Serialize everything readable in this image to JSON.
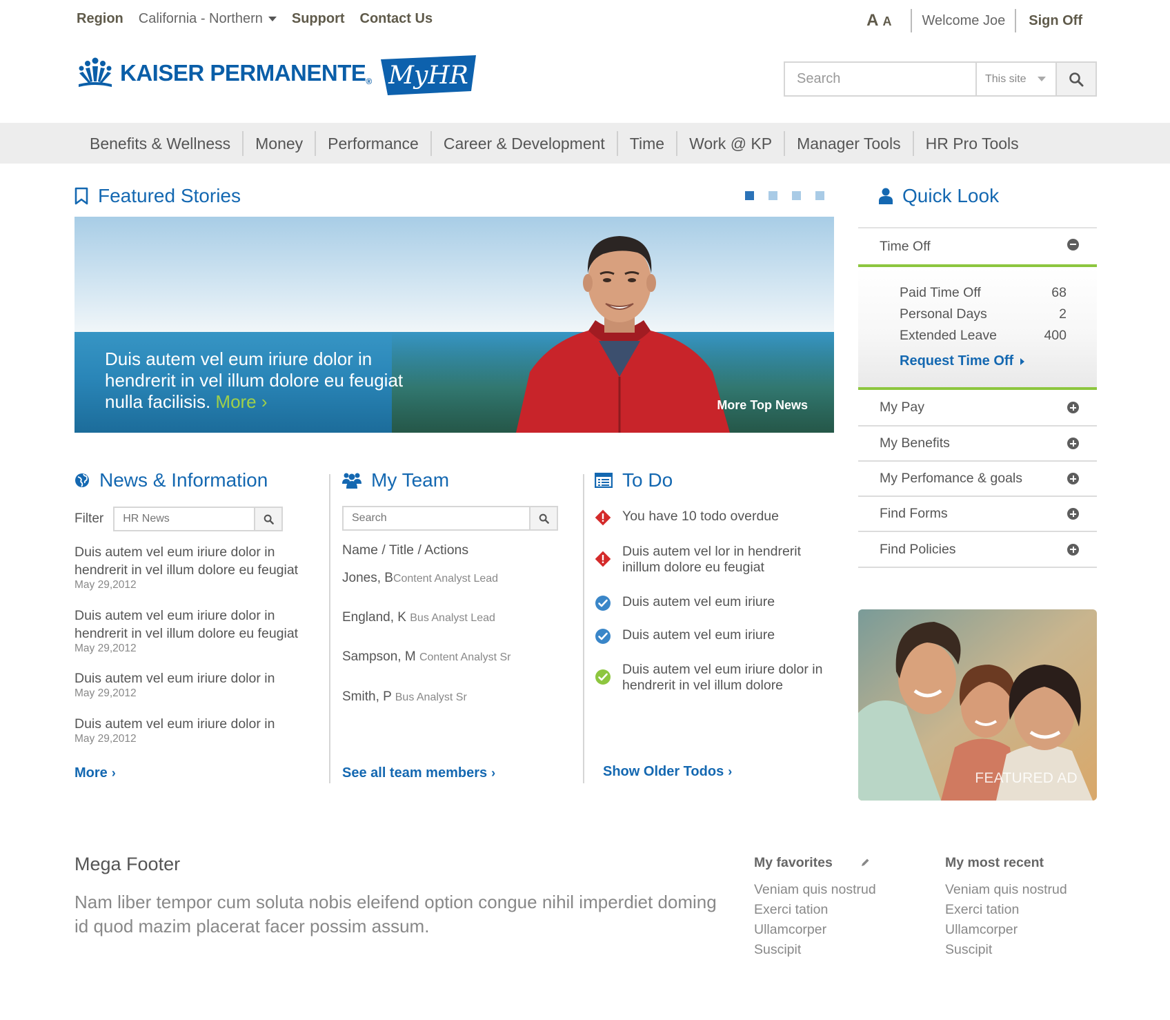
{
  "utility": {
    "region_label": "Region",
    "region_value": "California - Northern",
    "support": "Support",
    "contact": "Contact Us",
    "text_size_large": "A",
    "text_size_small": "A",
    "welcome": "Welcome Joe",
    "sign_off": "Sign Off"
  },
  "brand": {
    "name": "KAISER PERMANENTE",
    "registered": "®",
    "app_logo": "MyHR",
    "brand_color": "#0a5ea8",
    "accent_green": "#8dc63f"
  },
  "search": {
    "placeholder": "Search",
    "scope": "This site"
  },
  "nav": {
    "items": [
      "Benefits & Wellness",
      "Money",
      "Performance",
      "Career & Development",
      "Time",
      "Work @ KP",
      "Manager Tools",
      "HR Pro Tools"
    ]
  },
  "featured": {
    "title": "Featured Stories",
    "caption": "Duis autem vel eum iriure dolor in hendrerit in vel illum dolore eu feugiat nulla facilisis.",
    "more": "More ›",
    "more_top_news": "More Top News",
    "slides": 4,
    "active_slide": 1
  },
  "news": {
    "title": "News  & Information",
    "filter_label": "Filter",
    "filter_placeholder": "HR News",
    "items": [
      {
        "text": "Duis autem vel eum iriure dolor in hendrerit in vel illum dolore eu feugiat",
        "date": "May 29,2012"
      },
      {
        "text": "Duis autem vel eum iriure dolor in hendrerit in vel illum dolore eu feugiat",
        "date": "May 29,2012"
      },
      {
        "text": "Duis autem vel eum iriure dolor in",
        "date": "May 29,2012"
      },
      {
        "text": "Duis autem vel eum iriure dolor in",
        "date": "May 29,2012"
      }
    ],
    "more": "More"
  },
  "team": {
    "title": "My Team",
    "search_placeholder": "Search",
    "header": "Name / Title / Actions",
    "members": [
      {
        "name": "Jones, B",
        "role": "Content Analyst Lead"
      },
      {
        "name": "England, K",
        "role": "Bus Analyst Lead"
      },
      {
        "name": "Sampson, M",
        "role": "Content Analyst Sr"
      },
      {
        "name": "Smith, P",
        "role": "Bus Analyst Sr"
      }
    ],
    "see_all": "See all team members"
  },
  "todo": {
    "title": "To Do",
    "items": [
      {
        "status": "overdue",
        "text": "You have 10 todo overdue"
      },
      {
        "status": "overdue",
        "text": "Duis autem vel lor in hendrerit inillum dolore eu feugiat"
      },
      {
        "status": "pending",
        "text": "Duis autem vel eum iriure"
      },
      {
        "status": "pending",
        "text": "Duis autem vel eum iriure"
      },
      {
        "status": "complete",
        "text": "Duis autem vel eum iriure dolor in hendrerit in vel illum dolore"
      }
    ],
    "show_older": "Show Older Todos"
  },
  "quicklook": {
    "title": "Quick Look",
    "time_off": {
      "label": "Time Off",
      "rows": [
        {
          "label": "Paid Time Off",
          "value": "68"
        },
        {
          "label": "Personal Days",
          "value": "2"
        },
        {
          "label": "Extended Leave",
          "value": "400"
        }
      ],
      "request": "Request Time Off"
    },
    "sections": [
      "My Pay",
      "My Benefits",
      "My Perfomance & goals",
      "Find Forms",
      "Find Policies"
    ]
  },
  "ad": {
    "label": "FEATURED AD"
  },
  "footer": {
    "title": "Mega Footer",
    "description": "Nam liber tempor cum soluta nobis eleifend option congue nihil imperdiet doming id quod mazim placerat facer possim assum.",
    "favorites_title": "My favorites",
    "favorites": [
      "Veniam quis nostrud",
      "Exerci tation",
      "Ullamcorper",
      "Suscipit"
    ],
    "recent_title": "My most recent",
    "recent": [
      "Veniam quis nostrud",
      "Exerci tation",
      "Ullamcorper",
      "Suscipit"
    ]
  }
}
